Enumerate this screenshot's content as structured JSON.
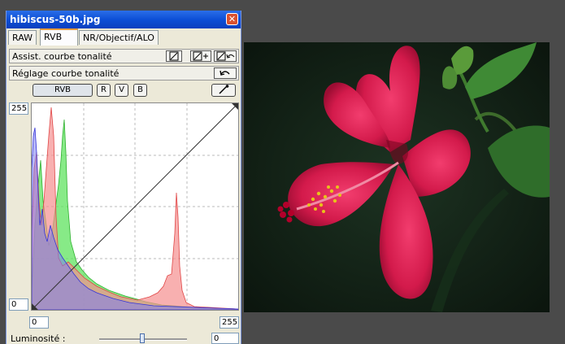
{
  "window": {
    "title": "hibiscus-50b.jpg",
    "close_symbol": "✕"
  },
  "tabs": [
    {
      "label": "RAW"
    },
    {
      "label": "RVB",
      "active": true
    },
    {
      "label": "NR/Objectif/ALO"
    }
  ],
  "tone_assist": {
    "label": "Assist. courbe tonalité"
  },
  "tone_curve": {
    "label": "Réglage courbe tonalité"
  },
  "channels": {
    "rgb": "RVB",
    "r": "R",
    "v": "V",
    "b": "B"
  },
  "levels": {
    "out_max": "255",
    "out_min": "0",
    "in_min": "0",
    "in_max": "255"
  },
  "brightness": {
    "label": "Luminosité :",
    "value": "0"
  },
  "colors": {
    "red": "#f58f8f",
    "green": "#5fe35f",
    "blue": "#7b7bf0",
    "window_bg": "#ece9d8",
    "title_bar": "#0d4fd6"
  }
}
